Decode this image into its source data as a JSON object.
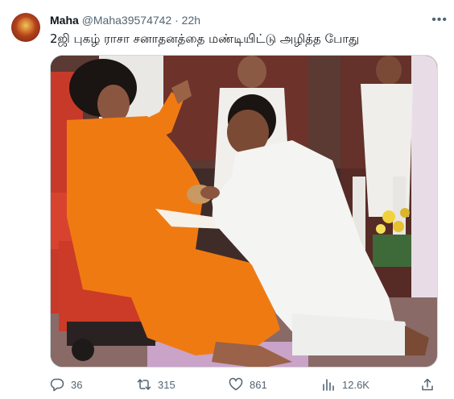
{
  "tweet": {
    "author_name": "Maha",
    "handle": "@Maha39574742",
    "separator": "·",
    "time": "22h",
    "more_label": "•••",
    "text": "2ஜி புகழ் ராசா சனாதனத்தை மண்டியிட்டு அழித்த போது"
  },
  "actions": {
    "reply_count": "36",
    "retweet_count": "315",
    "like_count": "861",
    "view_count": "12.6K"
  },
  "icons": {
    "reply": "comment-icon",
    "retweet": "retweet-icon",
    "like": "heart-icon",
    "views": "analytics-icon",
    "share": "share-icon",
    "more": "more-icon"
  },
  "colors": {
    "text_primary": "#0f1419",
    "text_secondary": "#536471",
    "border": "#cfd9de"
  }
}
